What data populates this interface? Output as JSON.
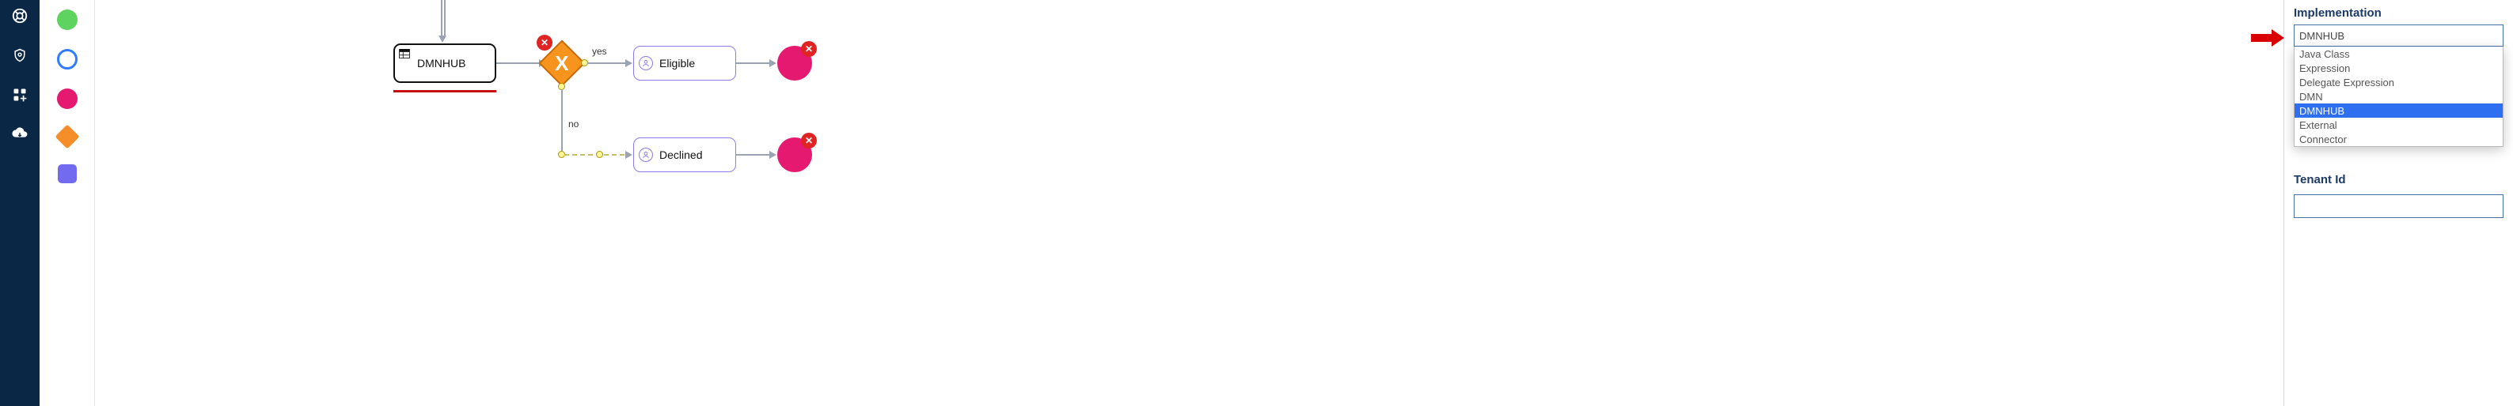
{
  "leftnav": {
    "items": [
      {
        "name": "life-ring-icon"
      },
      {
        "name": "shield-icon"
      },
      {
        "name": "apps-add-icon"
      },
      {
        "name": "cloud-download-icon"
      }
    ]
  },
  "palette": {
    "items": [
      {
        "name": "start-event-green"
      },
      {
        "name": "intermediate-event-blue"
      },
      {
        "name": "end-event-magenta"
      },
      {
        "name": "gateway-orange"
      },
      {
        "name": "task-purple"
      }
    ]
  },
  "canvas": {
    "task": {
      "label": "DMNHUB"
    },
    "gateway": {
      "symbol": "X"
    },
    "flows": {
      "yes_label": "yes",
      "no_label": "no"
    },
    "eligible": {
      "label": "Eligible"
    },
    "declined": {
      "label": "Declined"
    },
    "remove_badge": "✕"
  },
  "panel": {
    "implementation": {
      "label": "Implementation",
      "value": "DMNHUB",
      "options": [
        "Java Class",
        "Expression",
        "Delegate Expression",
        "DMN",
        "DMNHUB",
        "External",
        "Connector"
      ],
      "selected": "DMNHUB"
    },
    "tenant": {
      "label": "Tenant Id",
      "value": ""
    }
  }
}
